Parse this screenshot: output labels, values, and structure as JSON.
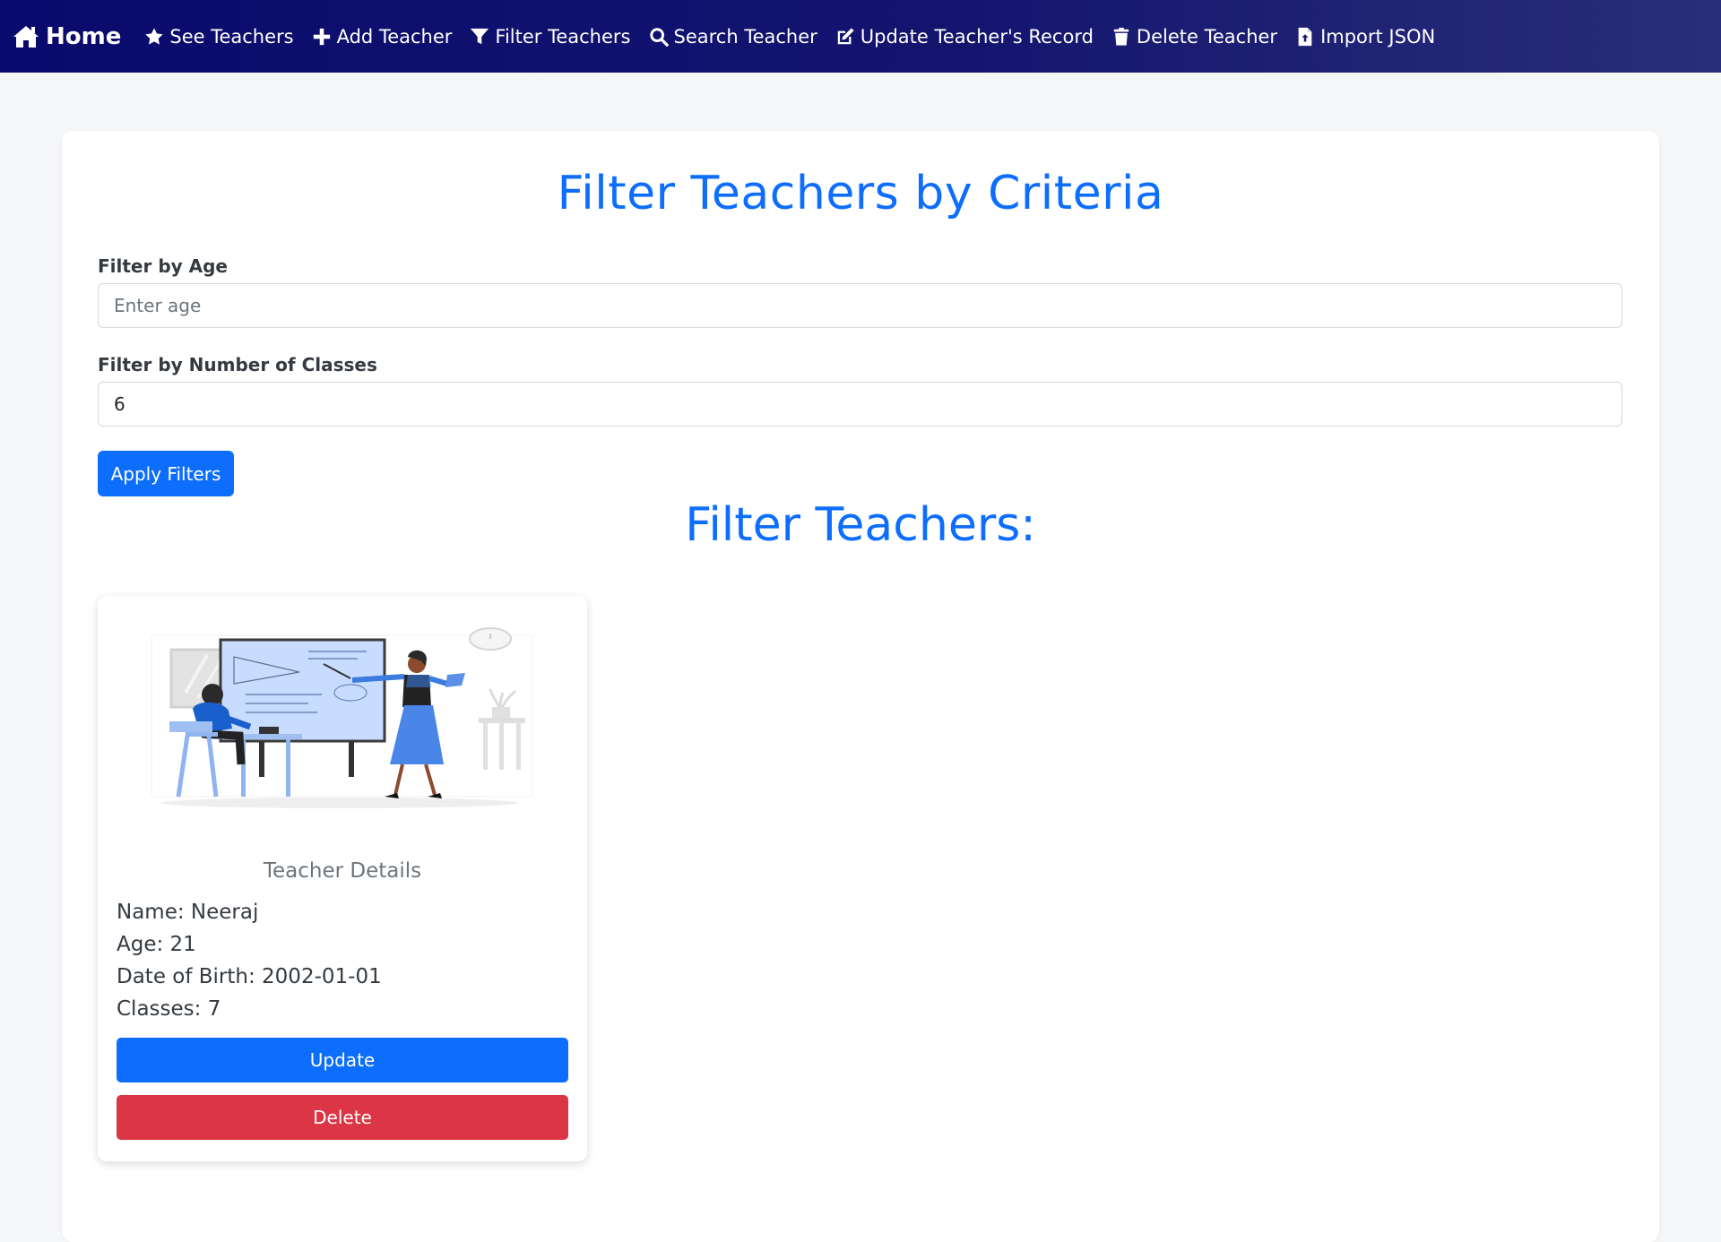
{
  "nav": {
    "home": {
      "label": "Home",
      "icon": "home-icon"
    },
    "items": [
      {
        "label": "See Teachers",
        "icon": "star-icon"
      },
      {
        "label": "Add Teacher",
        "icon": "plus-icon"
      },
      {
        "label": "Filter Teachers",
        "icon": "filter-icon"
      },
      {
        "label": "Search Teacher",
        "icon": "search-icon"
      },
      {
        "label": "Update Teacher's Record",
        "icon": "edit-icon"
      },
      {
        "label": "Delete Teacher",
        "icon": "trash-icon"
      },
      {
        "label": "Import JSON",
        "icon": "file-import-icon"
      }
    ]
  },
  "filter": {
    "title": "Filter Teachers by Criteria",
    "age_label": "Filter by Age",
    "age_placeholder": "Enter age",
    "age_value": "",
    "classes_label": "Filter by Number of Classes",
    "classes_placeholder": "",
    "classes_value": "6",
    "apply_label": "Apply Filters"
  },
  "results": {
    "title": "Filter Teachers:",
    "card": {
      "heading": "Teacher Details",
      "name": "Name: Neeraj",
      "age": "Age: 21",
      "dob": "Date of Birth: 2002-01-01",
      "classes": "Classes: 7",
      "update_label": "Update",
      "delete_label": "Delete"
    }
  },
  "colors": {
    "primary": "#0d6efd",
    "danger": "#dc3545",
    "navbar": "#0a0a6e"
  }
}
